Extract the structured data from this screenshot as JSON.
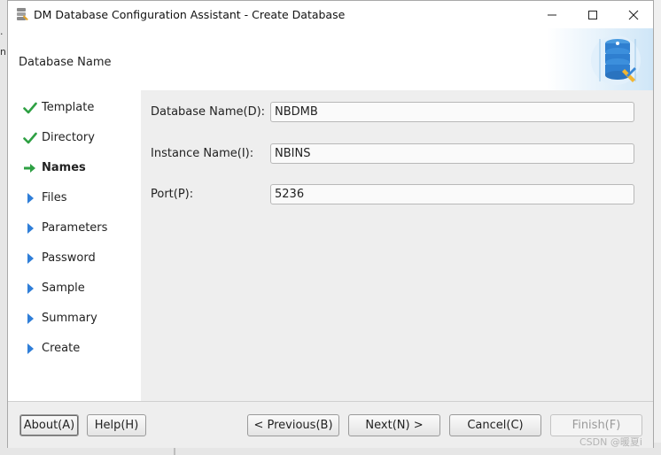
{
  "background": {
    "left_text_1": "·",
    "left_text_2": "n"
  },
  "window": {
    "title": "DM Database Configuration Assistant - Create Database"
  },
  "header": {
    "title": "Database Name"
  },
  "nav": {
    "items": [
      {
        "label": "Template",
        "state": "done"
      },
      {
        "label": "Directory",
        "state": "done"
      },
      {
        "label": "Names",
        "state": "current"
      },
      {
        "label": "Files",
        "state": "pending"
      },
      {
        "label": "Parameters",
        "state": "pending"
      },
      {
        "label": "Password",
        "state": "pending"
      },
      {
        "label": "Sample",
        "state": "pending"
      },
      {
        "label": "Summary",
        "state": "pending"
      },
      {
        "label": "Create",
        "state": "pending"
      }
    ]
  },
  "form": {
    "db_name_label": "Database Name(D):",
    "db_name_value": "NBDMB",
    "instance_label": "Instance Name(I):",
    "instance_value": "NBINS",
    "port_label": "Port(P):",
    "port_value": "5236"
  },
  "buttons": {
    "about": "About(A)",
    "help": "Help(H)",
    "previous": "< Previous(B)",
    "next": "Next(N) >",
    "cancel": "Cancel(C)",
    "finish": "Finish(F)"
  },
  "watermark": "CSDN @暖夏i",
  "colors": {
    "check": "#2ea043",
    "arrow_current": "#2ea043",
    "arrow_pending": "#2f7ed8"
  },
  "icons": {
    "done": "check-icon",
    "current": "arrow-right-icon",
    "pending": "triangle-right-icon"
  }
}
